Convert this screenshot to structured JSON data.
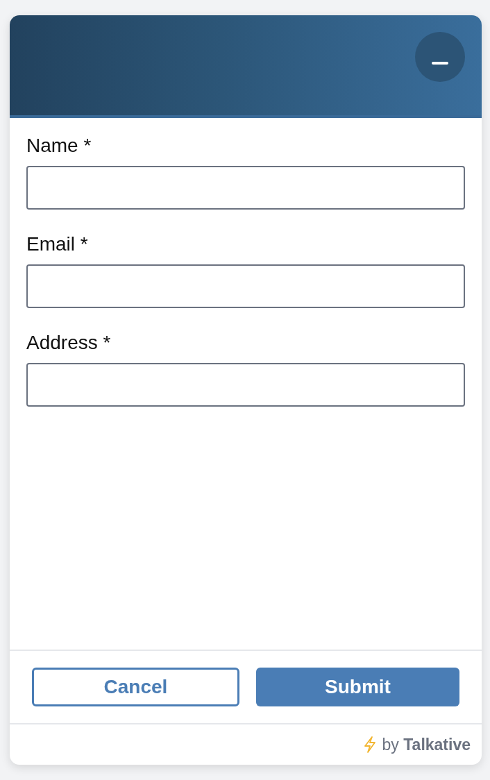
{
  "fields": [
    {
      "label": "Name *"
    },
    {
      "label": "Email *"
    },
    {
      "label": "Address *"
    }
  ],
  "buttons": [
    {
      "label": "Cancel",
      "kind": "secondary"
    },
    {
      "label": "Submit",
      "kind": "primary"
    }
  ],
  "footer": {
    "credit": "by **Talkative**"
  }
}
